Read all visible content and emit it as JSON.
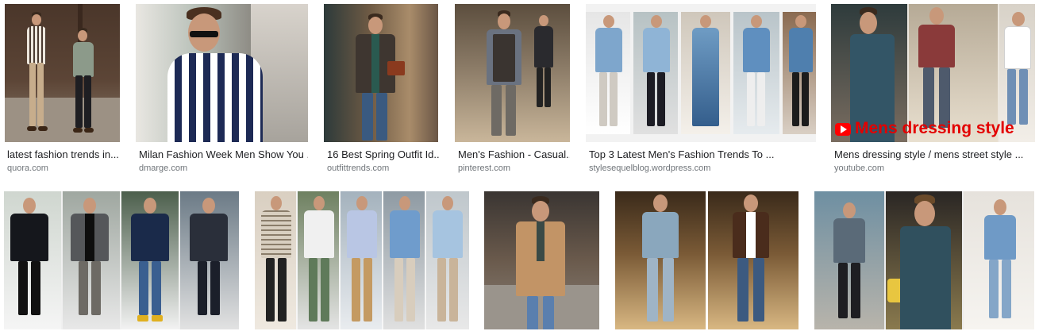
{
  "results": [
    {
      "title": "latest fashion trends in...",
      "source": "quora.com"
    },
    {
      "title": "Milan Fashion Week Men Show You ...",
      "source": "dmarge.com"
    },
    {
      "title": "16 Best Spring Outfit Id...",
      "source": "outfittrends.com"
    },
    {
      "title": "Men's Fashion - Casual...",
      "source": "pinterest.com"
    },
    {
      "title": "Top 3 Latest Men's Fashion Trends To ...",
      "source": "stylesequelblog.wordpress.com"
    },
    {
      "title": "Mens dressing style / mens street style ...",
      "source": "youtube.com",
      "overlay": "Mens dressing style"
    },
    {
      "title": "",
      "source": ""
    },
    {
      "title": "",
      "source": ""
    },
    {
      "title": "",
      "source": ""
    },
    {
      "title": "",
      "source": ""
    },
    {
      "title": "",
      "source": ""
    }
  ],
  "icons": {
    "video_badge": "play-icon"
  },
  "colors": {
    "title": "#202124",
    "source": "#70757a",
    "overlay_text": "#e30000",
    "youtube_red": "#ff0000"
  }
}
